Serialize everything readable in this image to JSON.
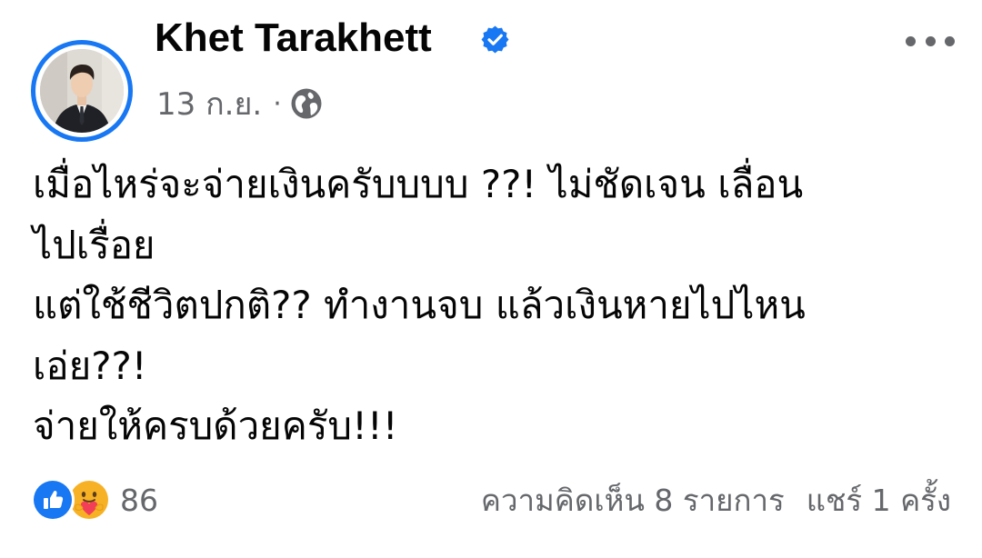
{
  "post": {
    "author": {
      "name": "Khet Tarakhett",
      "verified": true,
      "avatar": "profile-photo"
    },
    "date": "13 ก.ย.",
    "separator": "·",
    "audience_icon": "globe-icon",
    "more_icon": "more-horizontal-icon",
    "body_lines": [
      "เมื่อไหร่จะจ่ายเงินครับบบบ ??! ไม่ชัดเจน เลื่อน",
      "ไปเรื่อย",
      "แต่ใช้ชีวิตปกติ??  ทำงานจบ แล้วเงินหายไปไหน",
      "เอ่ย??!",
      "จ่ายให้ครบด้วยครับ!!!"
    ],
    "reactions": {
      "icons": [
        "like-icon",
        "care-icon"
      ],
      "count": "86"
    },
    "comments_label": "ความคิดเห็น 8 รายการ",
    "shares_label": "แชร์ 1 ครั้ง"
  },
  "colors": {
    "accent": "#1877f2",
    "text_primary": "#050505",
    "text_secondary": "#65676b",
    "like_blue": "#1877f2",
    "care_yellow": "#f7b125",
    "care_heart": "#f33e58"
  }
}
